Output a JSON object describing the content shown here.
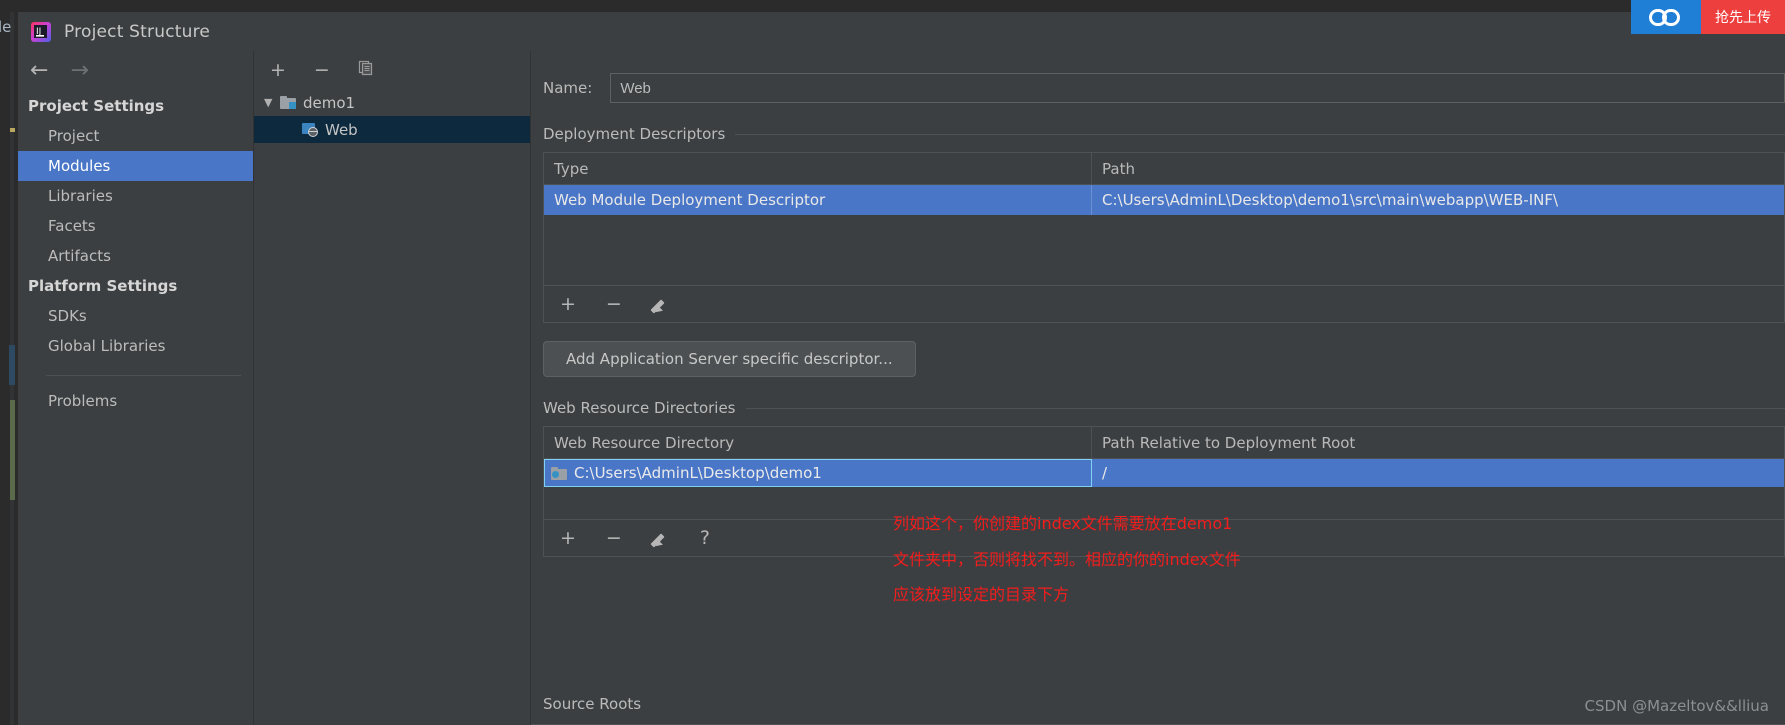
{
  "window": {
    "title": "Project Structure",
    "app_icon": "intellij-idea-logo",
    "behind_text": "le"
  },
  "nav": {
    "back_icon": "arrow-left-icon",
    "forward_icon": "arrow-right-icon",
    "groups": [
      {
        "label": "Project Settings",
        "items": [
          {
            "label": "Project",
            "selected": false
          },
          {
            "label": "Modules",
            "selected": true
          },
          {
            "label": "Libraries",
            "selected": false
          },
          {
            "label": "Facets",
            "selected": false
          },
          {
            "label": "Artifacts",
            "selected": false
          }
        ]
      },
      {
        "label": "Platform Settings",
        "items": [
          {
            "label": "SDKs",
            "selected": false
          },
          {
            "label": "Global Libraries",
            "selected": false
          }
        ]
      }
    ],
    "problems_label": "Problems"
  },
  "tree": {
    "toolbar": [
      {
        "icon": "plus-icon",
        "label": "+"
      },
      {
        "icon": "minus-icon",
        "label": "−"
      },
      {
        "icon": "copy-icon",
        "label": "❐"
      }
    ],
    "nodes": [
      {
        "label": "demo1",
        "icon": "module-folder-icon",
        "expanded": true,
        "selected": false,
        "chevron": "⌄"
      },
      {
        "label": "Web",
        "icon": "web-facet-icon",
        "child": true,
        "selected": true
      }
    ]
  },
  "main": {
    "name_label": "Name:",
    "name_value": "Web",
    "deployment": {
      "section_title": "Deployment Descriptors",
      "columns": [
        "Type",
        "Path"
      ],
      "rows": [
        {
          "type": "Web Module Deployment Descriptor",
          "path": "C:\\Users\\AdminL\\Desktop\\demo1\\src\\main\\webapp\\WEB-INF\\",
          "selected": true
        }
      ],
      "toolbar": [
        {
          "icon": "plus-icon",
          "label": "+"
        },
        {
          "icon": "minus-icon",
          "label": "−"
        },
        {
          "icon": "edit-pencil-icon",
          "label": ""
        }
      ],
      "add_descriptor_button": "Add Application Server specific descriptor..."
    },
    "web_resources": {
      "section_title": "Web Resource Directories",
      "columns": [
        "Web Resource Directory",
        "Path Relative to Deployment Root"
      ],
      "rows": [
        {
          "directory": "C:\\Users\\AdminL\\Desktop\\demo1",
          "relative_path": "/",
          "icon": "directory-icon",
          "selected": true
        }
      ],
      "toolbar": [
        {
          "icon": "plus-icon",
          "label": "+"
        },
        {
          "icon": "minus-icon",
          "label": "−"
        },
        {
          "icon": "edit-pencil-icon",
          "label": ""
        },
        {
          "icon": "help-question-icon",
          "label": "?"
        }
      ]
    },
    "source_roots_title": "Source Roots"
  },
  "annotations": {
    "color": "#f41c1c",
    "lines": [
      "列如这个，你创建的index文件需要放在demo1",
      "文件夹中，否则将找不到。相应的你的index文件",
      "应该放到设定的目录下方"
    ]
  },
  "watermark": "CSDN @Mazeltov&&lliua",
  "badge": {
    "icon": "link-chain-icon",
    "label": "抢先上传",
    "blue": "#1f7fd6",
    "red": "#ee3f3f"
  },
  "theme": {
    "background": "#3c3f41",
    "selection_blue": "#4a76c7",
    "tree_selection": "#0d293e",
    "border": "#4f5254",
    "text": "#bbbbbb"
  }
}
